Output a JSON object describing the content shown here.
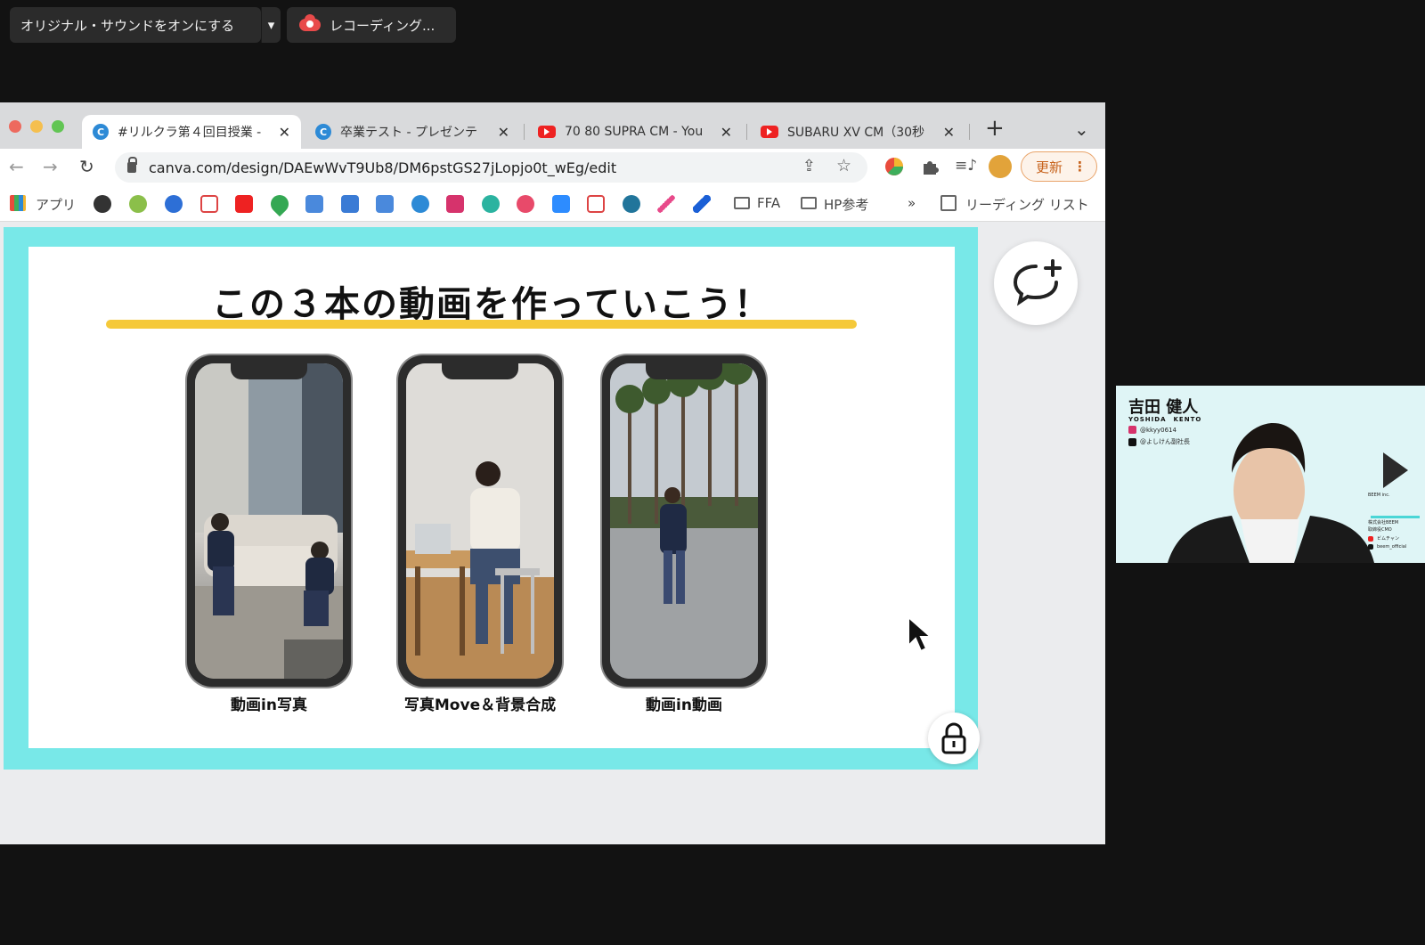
{
  "zoom": {
    "sound_label": "オリジナル・サウンドをオンにする",
    "dropdown_icon": "▾",
    "recording_label": "レコーディング..."
  },
  "browser": {
    "tabs": [
      {
        "title": "#リルクラ第４回目授業 -",
        "favicon": "canva-icon",
        "active": true
      },
      {
        "title": "卒業テスト - プレゼンテ",
        "favicon": "canva-icon",
        "active": false
      },
      {
        "title": "70 80 SUPRA CM - You",
        "favicon": "youtube-icon",
        "active": false
      },
      {
        "title": "SUBARU XV CM（30秒",
        "favicon": "youtube-icon",
        "active": false
      }
    ],
    "new_tab_icon": "+",
    "tab_menu_icon": "⌄",
    "url": "canva.com/design/DAEwWvT9Ub8/DM6pstGS27jLopjo0t_wEg/edit",
    "update_label": "更新",
    "update_menu": "⋮",
    "bookmarks": {
      "apps_label": "アプリ",
      "folder1": "FFA",
      "folder2": "HP参考",
      "overflow": "»",
      "reading_list": "リーディング リスト"
    }
  },
  "slide": {
    "title": "この３本の動画を作っていこう！",
    "captions": [
      "動画in写真",
      "写真Move＆背景合成",
      "動画in動画"
    ]
  },
  "participant": {
    "name": "吉田 健人",
    "name_roman": "YOSHIDA　KENTO",
    "instagram": "@kkyy0614",
    "tiktok": "@よしけん副社長",
    "brand": "BEEM inc.",
    "company": "株式会社BEEM",
    "role": "取締役CMO",
    "youtube": "ビムチャン",
    "tiktok2": "beem_official"
  },
  "colors": {
    "slide_frame": "#78e8e8",
    "title_underline": "#f5c93a",
    "update_button": "#c7621b"
  }
}
